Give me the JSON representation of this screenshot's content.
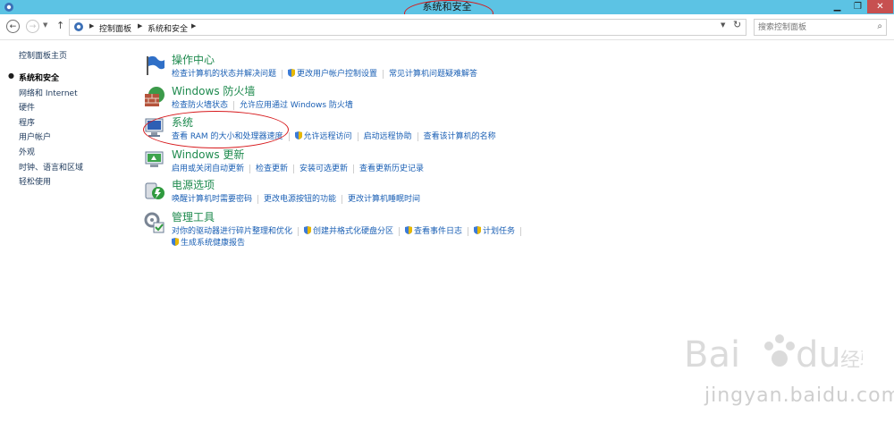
{
  "window": {
    "title": "系统和安全",
    "controls": {
      "minimize": "▁",
      "maximize": "❐",
      "close": "✕"
    }
  },
  "addressbar": {
    "crumbs": [
      "控制面板",
      "系统和安全"
    ],
    "search_placeholder": "搜索控制面板"
  },
  "leftnav": {
    "items": [
      {
        "label": "控制面板主页",
        "active": false
      },
      {
        "label": "系统和安全",
        "active": true
      },
      {
        "label": "网络和 Internet",
        "active": false
      },
      {
        "label": "硬件",
        "active": false
      },
      {
        "label": "程序",
        "active": false
      },
      {
        "label": "用户帐户",
        "active": false
      },
      {
        "label": "外观",
        "active": false
      },
      {
        "label": "时钟、语言和区域",
        "active": false
      },
      {
        "label": "轻松使用",
        "active": false
      }
    ]
  },
  "categories": [
    {
      "name": "action-center",
      "title": "操作中心",
      "icon": "flag-icon",
      "links": [
        "检查计算机的状态并解决问题",
        "更改用户帐户控制设置",
        "常见计算机问题疑难解答"
      ]
    },
    {
      "name": "firewall",
      "title": "Windows 防火墙",
      "icon": "firewall-icon",
      "links": [
        "检查防火墙状态",
        "允许应用通过 Windows 防火墙"
      ]
    },
    {
      "name": "system",
      "title": "系统",
      "icon": "computer-icon",
      "links": [
        "查看 RAM 的大小和处理器速度",
        "允许远程访问",
        "启动远程协助",
        "查看该计算机的名称"
      ]
    },
    {
      "name": "windows-update",
      "title": "Windows 更新",
      "icon": "update-icon",
      "links": [
        "启用或关闭自动更新",
        "检查更新",
        "安装可选更新",
        "查看更新历史记录"
      ]
    },
    {
      "name": "power-options",
      "title": "电源选项",
      "icon": "power-icon",
      "links": [
        "唤醒计算机时需要密码",
        "更改电源按钮的功能",
        "更改计算机睡眠时间"
      ]
    },
    {
      "name": "admin-tools",
      "title": "管理工具",
      "icon": "admin-tools-icon",
      "links": [
        "对你的驱动器进行碎片整理和优化",
        "创建并格式化硬盘分区",
        "查看事件日志",
        "计划任务",
        "生成系统健康报告"
      ]
    }
  ],
  "watermark": {
    "text": "jingyan.baidu.com",
    "logo": "Bai du 经验"
  },
  "colors": {
    "titlebar": "#5cc3e4",
    "heading": "#1e8a4e",
    "link": "#1a5fb4",
    "annotation": "#d7191c"
  }
}
